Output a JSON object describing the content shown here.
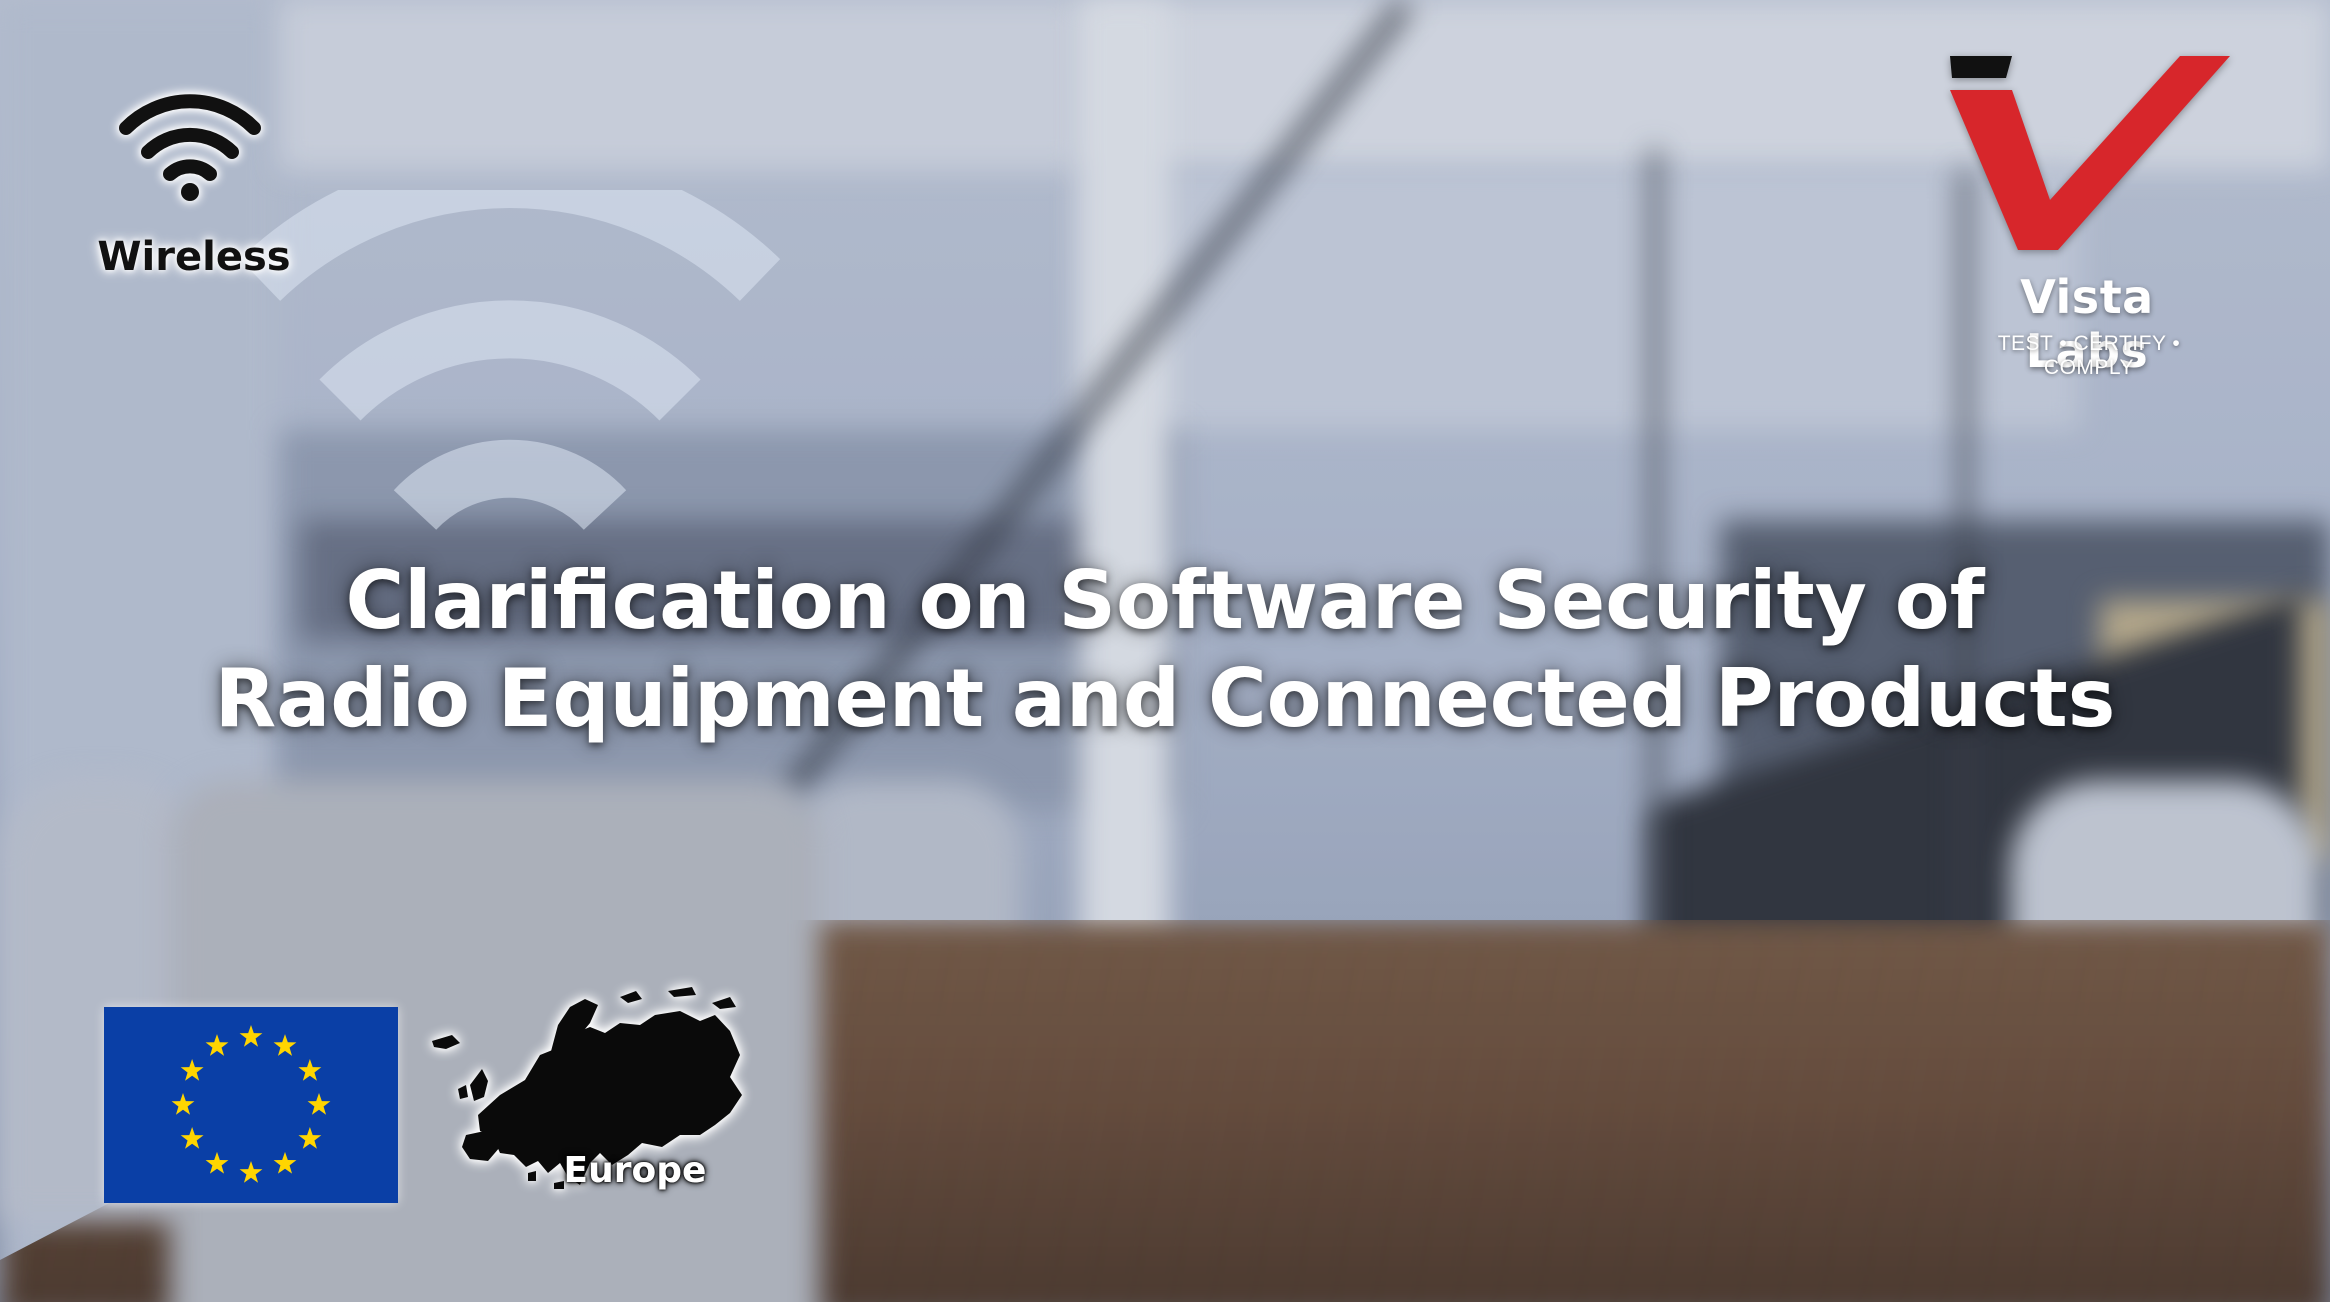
{
  "headline": {
    "line1": "Clarification on Software Security of",
    "line2": "Radio Equipment and Connected Products"
  },
  "wireless_badge": {
    "icon": "wifi-icon",
    "label": "Wireless"
  },
  "logo": {
    "name": "Vista Labs",
    "tagline": "TEST • CERTIFY • COMPLY",
    "colors": {
      "mark_red": "#d7262b",
      "mark_black": "#111111"
    }
  },
  "eu_flag": {
    "icon": "eu-flag-icon",
    "colors": {
      "field": "#0a3fa6",
      "stars": "#ffd500"
    },
    "star_count": 12
  },
  "europe_map": {
    "icon": "europe-map-icon",
    "label": "Europe"
  }
}
